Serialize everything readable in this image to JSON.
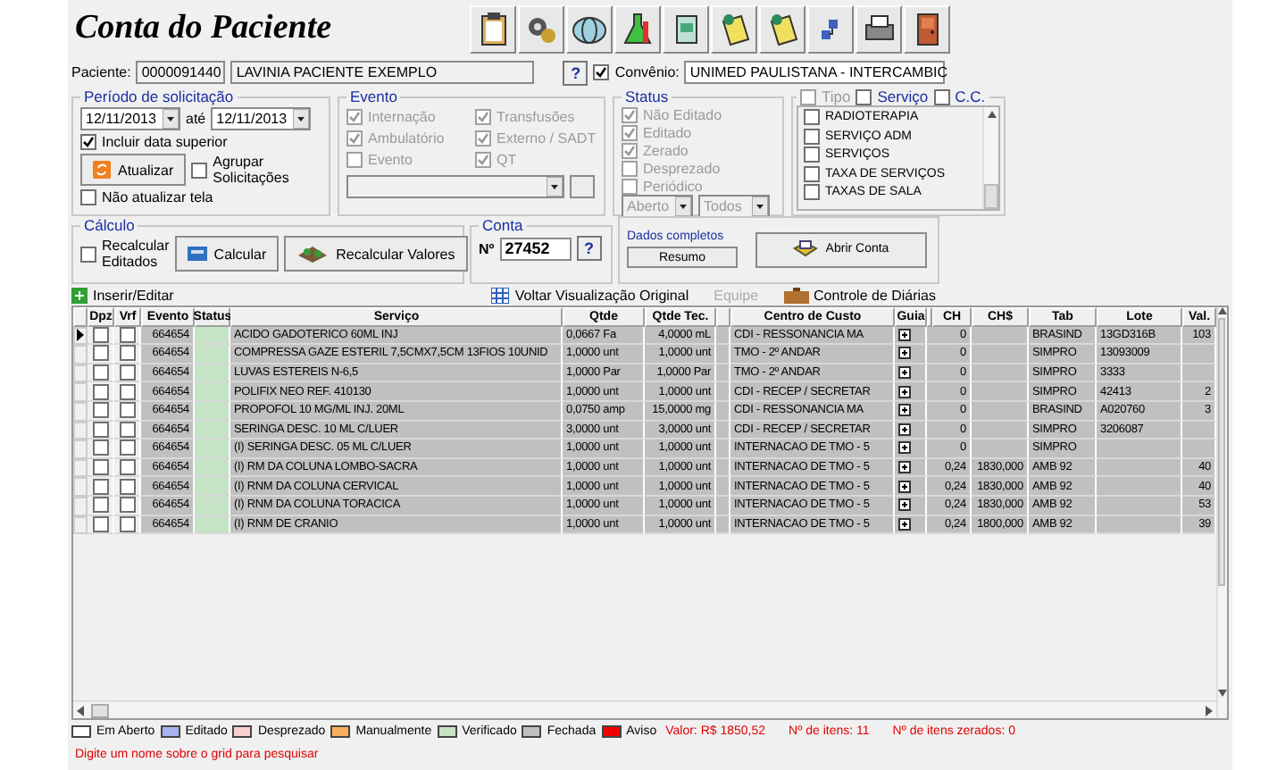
{
  "window": {
    "title": "Conta do Paciente"
  },
  "patient": {
    "label": "Paciente:",
    "code": "0000091440",
    "name": "LAVINIA PACIENTE EXEMPLO",
    "help": "?"
  },
  "convenio": {
    "label": "Convênio:",
    "checked": true,
    "value": "UNIMED PAULISTANA - INTERCAMBIC"
  },
  "periodo": {
    "title": "Período de solicitação",
    "from": "12/11/2013",
    "between": "até",
    "to": "12/11/2013",
    "options": [
      {
        "label": "Incluir data superior",
        "checked": true
      },
      {
        "label": "Agrupar Solicitações",
        "checked": false
      },
      {
        "label": "Não atualizar tela",
        "checked": false
      }
    ],
    "refresh_button": "Atualizar"
  },
  "evento": {
    "title": "Evento",
    "options": [
      {
        "label": "Internação",
        "checked": true
      },
      {
        "label": "Transfusões",
        "checked": true
      },
      {
        "label": "Ambulatório",
        "checked": true
      },
      {
        "label": "Externo / SADT",
        "checked": true
      },
      {
        "label": "Evento",
        "checked": false
      },
      {
        "label": "QT",
        "checked": true
      }
    ]
  },
  "status": {
    "title": "Status",
    "options": [
      {
        "label": "Não Editado",
        "checked": true
      },
      {
        "label": "Editado",
        "checked": true
      },
      {
        "label": "Zerado",
        "checked": true
      },
      {
        "label": "Desprezado",
        "checked": false
      },
      {
        "label": "Periódico",
        "checked": false
      }
    ],
    "combos": [
      "Aberto",
      "Todos"
    ]
  },
  "filter": {
    "headers": [
      {
        "label": "Tipo",
        "checked": false,
        "disabled": true
      },
      {
        "label": "Serviço",
        "checked": false,
        "disabled": false
      },
      {
        "label": "C.C.",
        "checked": false,
        "disabled": false
      }
    ],
    "items": [
      {
        "label": "RADIOTERAPIA",
        "checked": false
      },
      {
        "label": "SERVIÇO ADM",
        "checked": false
      },
      {
        "label": "SERVIÇOS",
        "checked": false
      },
      {
        "label": "TAXA DE SERVIÇOS",
        "checked": false
      },
      {
        "label": "TAXAS DE SALA",
        "checked": false
      }
    ]
  },
  "calculo": {
    "title": "Cálculo",
    "recalc": {
      "label": "Recalcular Editados",
      "checked": false
    },
    "calc_button": "Calcular",
    "recalc_button": "Recalcular Valores"
  },
  "conta": {
    "title": "Conta",
    "number_label": "Nº",
    "number": "27452",
    "help": "?"
  },
  "dados": {
    "link": "Dados completos",
    "summary_button": "Resumo",
    "open_button": "Abrir Conta"
  },
  "actions": [
    {
      "label": "Inserir/Editar",
      "disabled": false
    },
    {
      "label": "Voltar Visualização Original",
      "disabled": false
    },
    {
      "label": "Equipe",
      "disabled": true
    },
    {
      "label": "Controle de Diárias",
      "disabled": false
    }
  ],
  "table": {
    "columns": [
      "Dpz",
      "Vrf",
      "Evento",
      "Status",
      "Serviço",
      "Qtde",
      "Qtde Tec.",
      "Centro de Custo",
      "Guia",
      "CH",
      "CH$",
      "Tab",
      "Lote",
      "Val."
    ],
    "rows": [
      {
        "current": true,
        "dpz": false,
        "vrf": false,
        "evento": "664654",
        "color": "#c6e3c6",
        "servico": "ACIDO GADOTERICO 60ML INJ",
        "qtde": "0,0667 Fa",
        "qtde_tec": "4,0000 mL",
        "centro": "CDI - RESSONANCIA MA",
        "ch": "0",
        "tab": "BRASIND",
        "lote": "13GD316B",
        "val": "103"
      },
      {
        "current": false,
        "dpz": false,
        "vrf": false,
        "evento": "664654",
        "color": "#c6e3c6",
        "servico": "COMPRESSA GAZE ESTERIL 7,5CMX7,5CM 13FIOS 10UNID",
        "qtde": "1,0000 unt",
        "qtde_tec": "1,0000 unt",
        "centro": "TMO - 2º ANDAR",
        "ch": "0",
        "tab": "SIMPRO",
        "lote": "13093009"
      },
      {
        "current": false,
        "dpz": false,
        "vrf": false,
        "evento": "664654",
        "color": "#c6e3c6",
        "servico": "LUVAS ESTEREIS N-6,5",
        "qtde": "1,0000 Par",
        "qtde_tec": "1,0000 Par",
        "centro": "TMO - 2º ANDAR",
        "ch": "0",
        "tab": "SIMPRO",
        "lote": "3333"
      },
      {
        "current": false,
        "dpz": false,
        "vrf": false,
        "evento": "664654",
        "color": "#c6e3c6",
        "servico": "POLIFIX   NEO   REF. 410130",
        "qtde": "1,0000 unt",
        "qtde_tec": "1,0000 unt",
        "centro": "CDI - RECEP / SECRETAR",
        "ch": "0",
        "tab": "SIMPRO",
        "lote": "42413",
        "val": "2"
      },
      {
        "current": false,
        "dpz": false,
        "vrf": false,
        "evento": "664654",
        "color": "#c6e3c6",
        "servico": "PROPOFOL 10 MG/ML INJ. 20ML",
        "qtde": "0,0750 amp",
        "qtde_tec": "15,0000 mg",
        "centro": "CDI - RESSONANCIA MA",
        "ch": "0",
        "tab": "BRASIND",
        "lote": "A020760",
        "val": "3"
      },
      {
        "current": false,
        "dpz": false,
        "vrf": false,
        "evento": "664654",
        "color": "#c6e3c6",
        "servico": "SERINGA DESC. 10 ML C/LUER",
        "qtde": "3,0000 unt",
        "qtde_tec": "3,0000 unt",
        "centro": "CDI - RECEP / SECRETAR",
        "ch": "0",
        "tab": "SIMPRO",
        "lote": "3206087"
      },
      {
        "current": false,
        "dpz": false,
        "vrf": false,
        "evento": "664654",
        "color": "#c6e3c6",
        "servico": "(I) SERINGA DESC. 05 ML C/LUER",
        "qtde": "1,0000 unt",
        "qtde_tec": "1,0000 unt",
        "centro": "INTERNACAO DE TMO - 5",
        "ch": "0",
        "tab": "SIMPRO"
      },
      {
        "current": false,
        "dpz": false,
        "vrf": false,
        "evento": "664654",
        "color": "#c6e3c6",
        "servico": "(I) RM DA COLUNA LOMBO-SACRA",
        "qtde": "1,0000 unt",
        "qtde_tec": "1,0000 unt",
        "centro": "INTERNACAO DE TMO - 5",
        "ch": "0,24",
        "ch_cost": "1830,000",
        "tab": "AMB 92",
        "val": "40"
      },
      {
        "current": false,
        "dpz": false,
        "vrf": false,
        "evento": "664654",
        "color": "#c6e3c6",
        "servico": "(I) RNM DA COLUNA CERVICAL",
        "qtde": "1,0000 unt",
        "qtde_tec": "1,0000 unt",
        "centro": "INTERNACAO DE TMO - 5",
        "ch": "0,24",
        "ch_cost": "1830,000",
        "tab": "AMB 92",
        "val": "40"
      },
      {
        "current": false,
        "dpz": false,
        "vrf": false,
        "evento": "664654",
        "color": "#c6e3c6",
        "servico": "(I) RNM DA COLUNA TORACICA",
        "qtde": "1,0000 unt",
        "qtde_tec": "1,0000 unt",
        "centro": "INTERNACAO DE TMO - 5",
        "ch": "0,24",
        "ch_cost": "1830,000",
        "tab": "AMB 92",
        "val": "53"
      },
      {
        "current": false,
        "dpz": false,
        "vrf": false,
        "evento": "664654",
        "color": "#c6e3c6",
        "servico": "(I) RNM DE CRANIO",
        "qtde": "1,0000 unt",
        "qtde_tec": "1,0000 unt",
        "centro": "INTERNACAO DE TMO - 5",
        "ch": "0,24",
        "ch_cost": "1800,000",
        "tab": "AMB 92",
        "val": "39"
      }
    ]
  },
  "legend": [
    {
      "label": "Em Aberto",
      "color": "#ffffff"
    },
    {
      "label": "Editado",
      "color": "#a8b4f0"
    },
    {
      "label": "Desprezado",
      "color": "#f8d0d0"
    },
    {
      "label": "Manualmente",
      "color": "#f8b060"
    },
    {
      "label": "Verificado",
      "color": "#c6e3c6"
    },
    {
      "label": "Fechada",
      "color": "#c0c0c0"
    },
    {
      "label": "Aviso",
      "color": "#f00000"
    }
  ],
  "summary": [
    "Valor: R$ 1850,52",
    "Nº de itens: 11",
    "Nº de itens zerados: 0"
  ],
  "hint": "Digite um nome sobre o grid para pesquisar"
}
